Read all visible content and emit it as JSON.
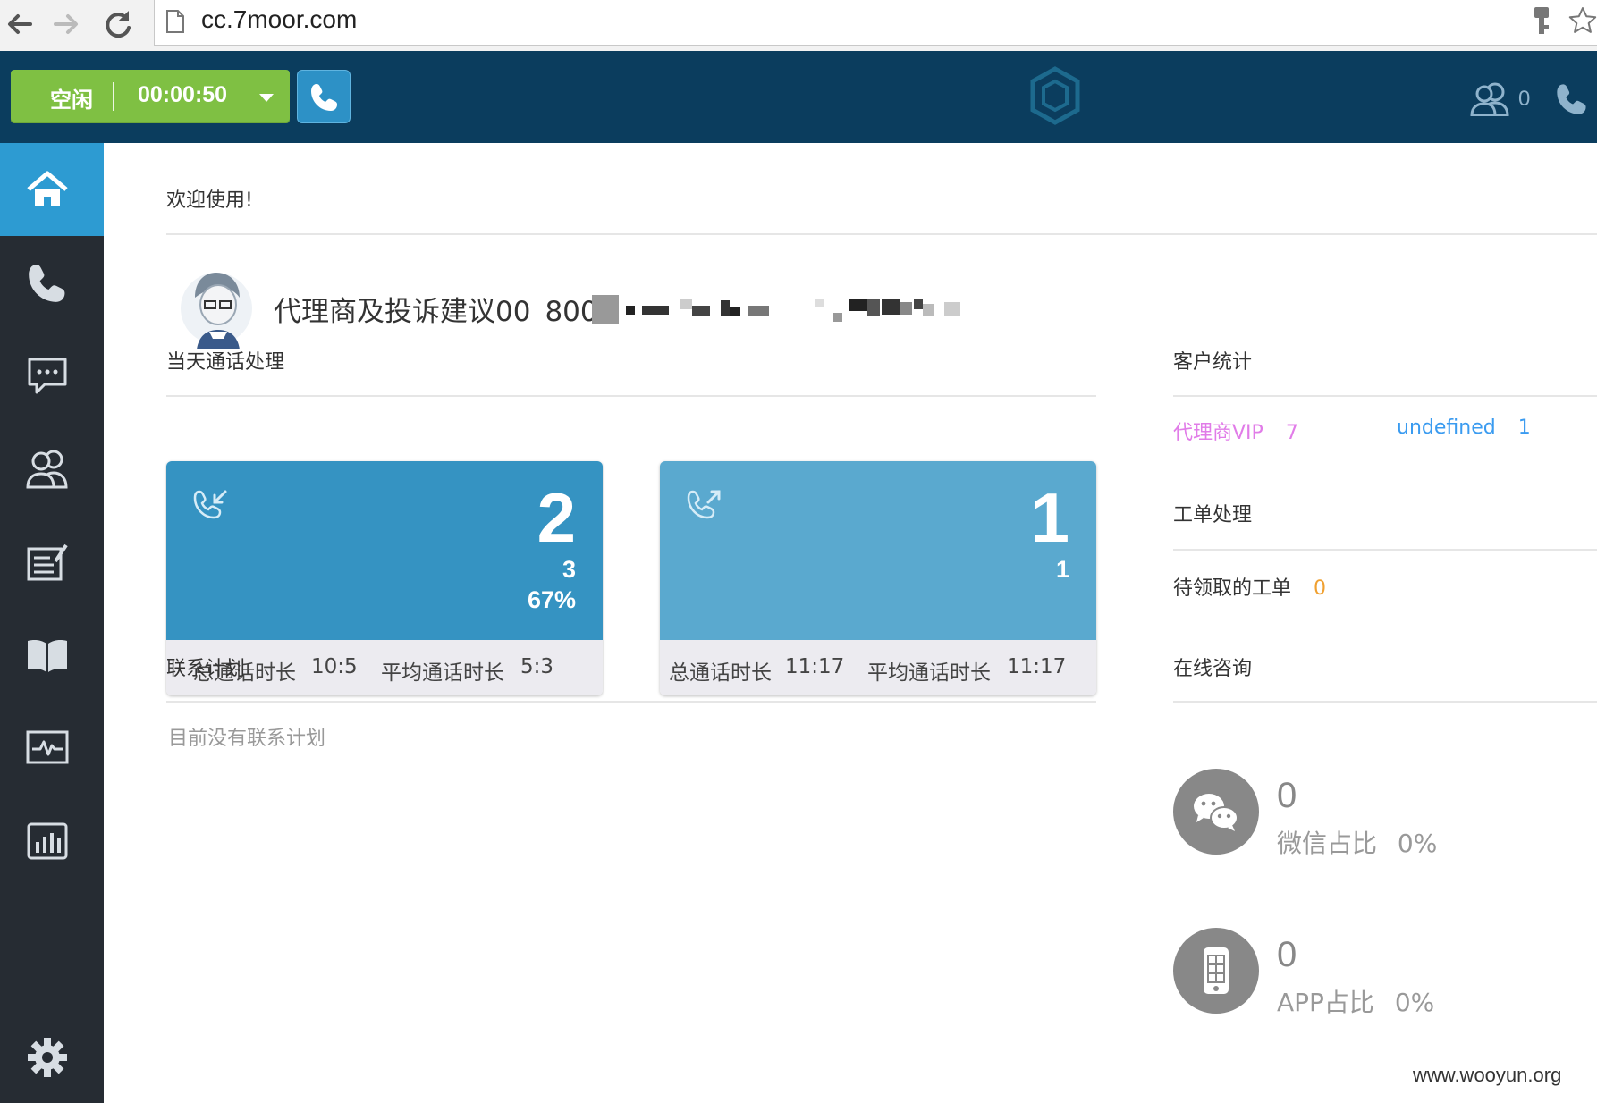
{
  "browser": {
    "url": "cc.7moor.com",
    "icons": [
      "back-arrow-icon",
      "forward-arrow-icon",
      "reload-icon",
      "page-icon",
      "key-icon",
      "star-icon"
    ]
  },
  "header": {
    "status_label": "空闲",
    "timer": "00:00:50",
    "agents_count": "0",
    "colors": {
      "bar": "#0b3d5e",
      "status": "#7fc043",
      "dial": "#2d91c6"
    }
  },
  "sidebar": {
    "items": [
      {
        "name": "home",
        "icon": "home-icon",
        "active": true
      },
      {
        "name": "calls",
        "icon": "phone-icon",
        "active": false
      },
      {
        "name": "chat",
        "icon": "chat-icon",
        "active": false
      },
      {
        "name": "customers",
        "icon": "users-icon",
        "active": false
      },
      {
        "name": "tickets",
        "icon": "edit-list-icon",
        "active": false
      },
      {
        "name": "knowledge",
        "icon": "book-icon",
        "active": false
      },
      {
        "name": "monitor",
        "icon": "monitor-icon",
        "active": false
      },
      {
        "name": "reports",
        "icon": "bar-chart-icon",
        "active": false
      },
      {
        "name": "settings",
        "icon": "gear-icon",
        "active": false
      }
    ],
    "active_color": "#2d9bd2"
  },
  "main": {
    "welcome": "欢迎使用!",
    "user": {
      "name": "代理商及投诉建议00",
      "ext": "8000"
    },
    "today_calls": {
      "title": "当天通话处理",
      "inbound": {
        "count": "2",
        "sub1": "3",
        "sub2": "67%",
        "total_label": "总通话时长",
        "total_value": "10:5",
        "avg_label": "平均通话时长",
        "avg_value": "5:3",
        "color": "#3593c2"
      },
      "outbound": {
        "count": "1",
        "sub1": "1",
        "total_label": "总通话时长",
        "total_value": "11:17",
        "avg_label": "平均通话时长",
        "avg_value": "11:17",
        "color": "#5aa9cf"
      }
    },
    "contact_plan": {
      "title": "联系计划",
      "empty": "目前没有联系计划"
    },
    "customer_stats": {
      "title": "客户统计",
      "items": [
        {
          "label": "代理商VIP",
          "value": "7",
          "color": "#e17ce8"
        },
        {
          "label": "undefined",
          "value": "1",
          "color": "#3a9bf0"
        }
      ]
    },
    "tickets": {
      "title": "工单处理",
      "pending_label": "待领取的工单",
      "pending_value": "0",
      "value_color": "#f0a030"
    },
    "online": {
      "title": "在线咨询",
      "wechat": {
        "count": "0",
        "label": "微信占比",
        "ratio": "0%"
      },
      "app": {
        "count": "0",
        "label": "APP占比",
        "ratio": "0%"
      }
    }
  },
  "watermark": "www.wooyun.org"
}
